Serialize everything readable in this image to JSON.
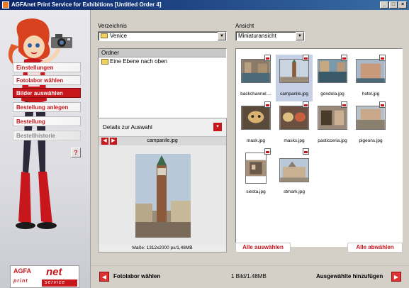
{
  "window": {
    "title": "AGFAnet Print Service for Exhibitions [Untitled Order 4]",
    "buttons": [
      "_",
      "□",
      "×"
    ]
  },
  "sidebar": {
    "items": [
      {
        "label": "Einstellungen",
        "state": "plain"
      },
      {
        "label": "Fotolabor wählen",
        "state": "plain"
      },
      {
        "label": "Bilder auswählen",
        "state": "active"
      },
      {
        "label": "Bestellung anlegen",
        "state": "plain"
      },
      {
        "label": "Bestellung",
        "state": "plain"
      },
      {
        "label": "Bestellhistorie",
        "state": "faded"
      }
    ],
    "help_label": "?",
    "logo": {
      "brand": "AGFA",
      "net": "net",
      "tagline_left": "print",
      "tagline_right": "service"
    }
  },
  "main": {
    "directory_label": "Verzeichnis",
    "directory_value": "Venice",
    "view_label": "Ansicht",
    "view_value": "Miniaturansicht",
    "folder_header": "Ordner",
    "folder_up": "Eine Ebene nach oben",
    "details_title": "Details zur Auswahl",
    "details_filename": "campanile.jpg",
    "details_info": "Maße: 1312x2000 px/1,48MB",
    "thumbnails": [
      {
        "name": "backchannel....",
        "selected": false
      },
      {
        "name": "campanile.jpg",
        "selected": true
      },
      {
        "name": "gondola.jpg",
        "selected": false
      },
      {
        "name": "hotel.jpg",
        "selected": false
      },
      {
        "name": "mask.jpg",
        "selected": false
      },
      {
        "name": "masks.jpg",
        "selected": false
      },
      {
        "name": "pasticceria.jpg",
        "selected": false
      },
      {
        "name": "pigeons.jpg",
        "selected": false
      },
      {
        "name": "siesta.jpg",
        "selected": false
      },
      {
        "name": "stmark.jpg",
        "selected": false
      }
    ],
    "select_all": "Alle auswählen",
    "deselect_all": "Alle abwählen"
  },
  "bottom": {
    "back_label": "Fotolabor wählen",
    "status": "1 Bild/1.48MB",
    "add_label": "Ausgewählte hinzufügen"
  },
  "colors": {
    "accent": "#c8161d",
    "title_bar": "#0a246a",
    "selected": "#c5d0e6"
  }
}
